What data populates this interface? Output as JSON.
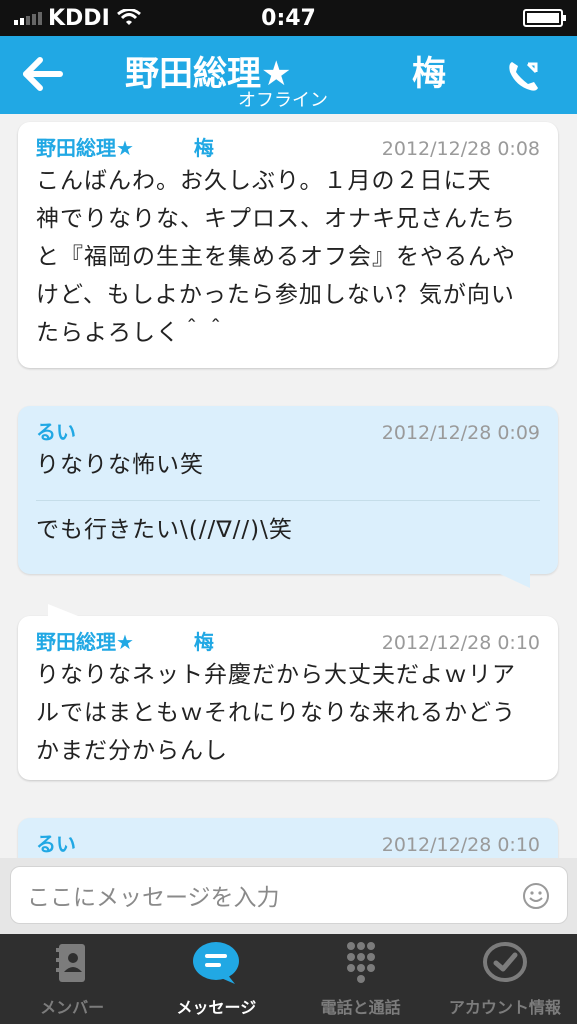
{
  "status_bar": {
    "carrier": "KDDI",
    "time": "0:47"
  },
  "header": {
    "title": "野田総理★",
    "title_suffix": "梅",
    "subtitle": "オフライン"
  },
  "messages": [
    {
      "sender": "野田総理★　　　梅",
      "timestamp": "2012/12/28 0:08",
      "lines": [
        "こんばんわ。お久しぶり。１月の２日に天",
        "神でりなりな、キプロス、オナキ兄さんたち",
        "と『福岡の生主を集めるオフ会』をやるんや",
        "けど、もしよかったら参加しない？気が向い",
        "たらよろしく＾＾"
      ]
    },
    {
      "sender": "るい",
      "timestamp": "2012/12/28 0:09",
      "text_1": "りなりな怖い笑",
      "text_2": "でも行きたい\\(//∇//)\\笑"
    },
    {
      "sender": "野田総理★　　　梅",
      "timestamp": "2012/12/28 0:10",
      "lines": [
        "りなりなネット弁慶だから大丈夫だよｗリア",
        "ルではまともｗそれにりなりな来れるかどう",
        "かまだ分からんし"
      ]
    },
    {
      "sender": "るい",
      "timestamp": "2012/12/28 0:10"
    }
  ],
  "composer": {
    "placeholder": "ここにメッセージを入力",
    "emoji_icon": "smiley-icon"
  },
  "tabs": [
    {
      "label": "メンバー",
      "icon": "contacts-icon",
      "active": false
    },
    {
      "label": "メッセージ",
      "icon": "chat-bubble-icon",
      "active": true
    },
    {
      "label": "電話と通話",
      "icon": "dialpad-icon",
      "active": false
    },
    {
      "label": "アカウント情報",
      "icon": "account-check-icon",
      "active": false
    }
  ],
  "colors": {
    "accent": "#21a8e4",
    "bubble_me": "#dbeffc",
    "tab_bar": "#2f2f2f"
  }
}
